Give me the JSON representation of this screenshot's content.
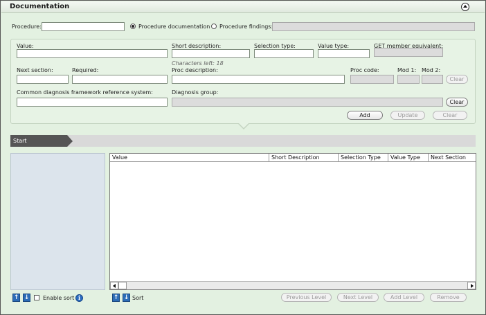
{
  "panel": {
    "title": "Documentation"
  },
  "procedure": {
    "label": "Procedure:",
    "value": "",
    "radio_doc_label": "Procedure documentation",
    "radio_find_label": "Procedure findings:",
    "selected": "documentation"
  },
  "form": {
    "value_label": "Value:",
    "short_desc_label": "Short description:",
    "chars_left": "Characters left: 18",
    "selection_type_label": "Selection type:",
    "value_type_label": "Value type:",
    "get_member_label": "GET member equivalent:",
    "next_section_label": "Next section:",
    "required_label": "Required:",
    "proc_desc_label": "Proc description:",
    "proc_code_label": "Proc code:",
    "mod1_label": "Mod 1:",
    "mod2_label": "Mod 2:",
    "clear_label": "Clear",
    "cdf_label": "Common diagnosis framework reference system:",
    "diag_group_label": "Diagnosis group:",
    "add_label": "Add",
    "update_label": "Update"
  },
  "breadcrumb": {
    "start": "Start"
  },
  "grid": {
    "columns": [
      "Value",
      "Short Description",
      "Selection Type",
      "Value Type",
      "Next Section"
    ]
  },
  "footer": {
    "enable_sort": "Enable sort",
    "sort": "Sort",
    "previous_level": "Previous Level",
    "next_level": "Next Level",
    "add_level": "Add Level",
    "remove": "Remove"
  },
  "icons": {
    "up": "arrow-up-icon",
    "down": "arrow-down-icon",
    "info": "info-icon",
    "collapse": "collapse-up-icon"
  },
  "colors": {
    "background": "#e3f1e1",
    "crumb": "#555555",
    "left_pane": "#dce4ec",
    "arrow_buttons": "#2c6cb7"
  }
}
